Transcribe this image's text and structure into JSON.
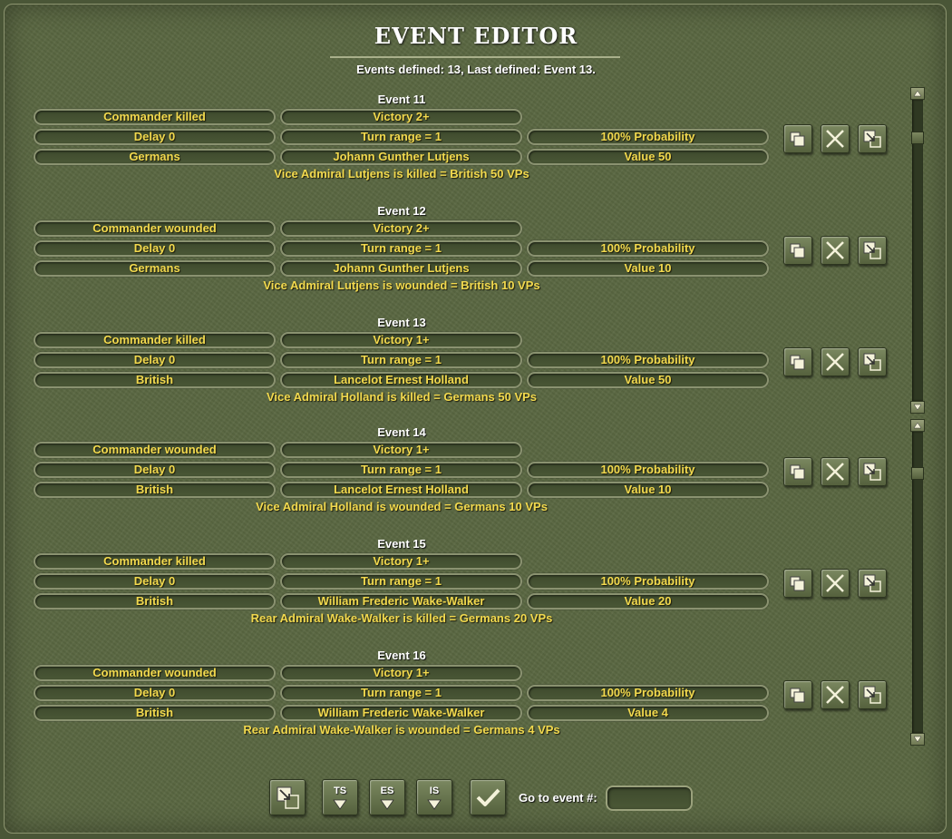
{
  "title": "EVENT EDITOR",
  "summary": "Events defined:  13, Last defined: Event  13.",
  "events": [
    {
      "title": "Event 11",
      "type": "Commander killed",
      "victory": "Victory 2+",
      "delay": "Delay 0",
      "turn_range": "Turn range = 1",
      "probability": "100% Probability",
      "side": "Germans",
      "commander": "Johann Gunther Lutjens",
      "value": "Value 50",
      "description": "Vice Admiral Lutjens is killed = British 50 VPs"
    },
    {
      "title": "Event 12",
      "type": "Commander wounded",
      "victory": "Victory 2+",
      "delay": "Delay 0",
      "turn_range": "Turn range = 1",
      "probability": "100% Probability",
      "side": "Germans",
      "commander": "Johann Gunther Lutjens",
      "value": "Value 10",
      "description": "Vice Admiral Lutjens is wounded = British 10 VPs"
    },
    {
      "title": "Event 13",
      "type": "Commander killed",
      "victory": "Victory 1+",
      "delay": "Delay 0",
      "turn_range": "Turn range = 1",
      "probability": "100% Probability",
      "side": "British",
      "commander": "Lancelot Ernest Holland",
      "value": "Value 50",
      "description": "Vice Admiral Holland is killed = Germans 50 VPs"
    },
    {
      "title": "Event 14",
      "type": "Commander wounded",
      "victory": "Victory 1+",
      "delay": "Delay 0",
      "turn_range": "Turn range = 1",
      "probability": "100% Probability",
      "side": "British",
      "commander": "Lancelot Ernest Holland",
      "value": "Value 10",
      "description": "Vice Admiral Holland is wounded = Germans 10 VPs"
    },
    {
      "title": "Event 15",
      "type": "Commander killed",
      "victory": "Victory 1+",
      "delay": "Delay 0",
      "turn_range": "Turn range = 1",
      "probability": "100% Probability",
      "side": "British",
      "commander": "William Frederic Wake-Walker",
      "value": "Value 20",
      "description": "Rear Admiral Wake-Walker is killed = Germans 20 VPs"
    },
    {
      "title": "Event 16",
      "type": "Commander wounded",
      "victory": "Victory 1+",
      "delay": "Delay 0",
      "turn_range": "Turn range = 1",
      "probability": "100% Probability",
      "side": "British",
      "commander": "William Frederic Wake-Walker",
      "value": "Value 4",
      "description": "Rear Admiral Wake-Walker is wounded = Germans 4 VPs"
    }
  ],
  "row_icons": [
    "copy-icon",
    "delete-icon",
    "paste-icon"
  ],
  "toolbar": {
    "new_icon": "paste-icon",
    "ts_label": "TS",
    "es_label": "ES",
    "is_label": "IS",
    "confirm_icon": "checkmark-icon",
    "goto_label": "Go to event #:",
    "goto_value": ""
  },
  "colors": {
    "background": "#5a6742",
    "field_text": "#f2d94e",
    "title_text": "#ffffff"
  }
}
